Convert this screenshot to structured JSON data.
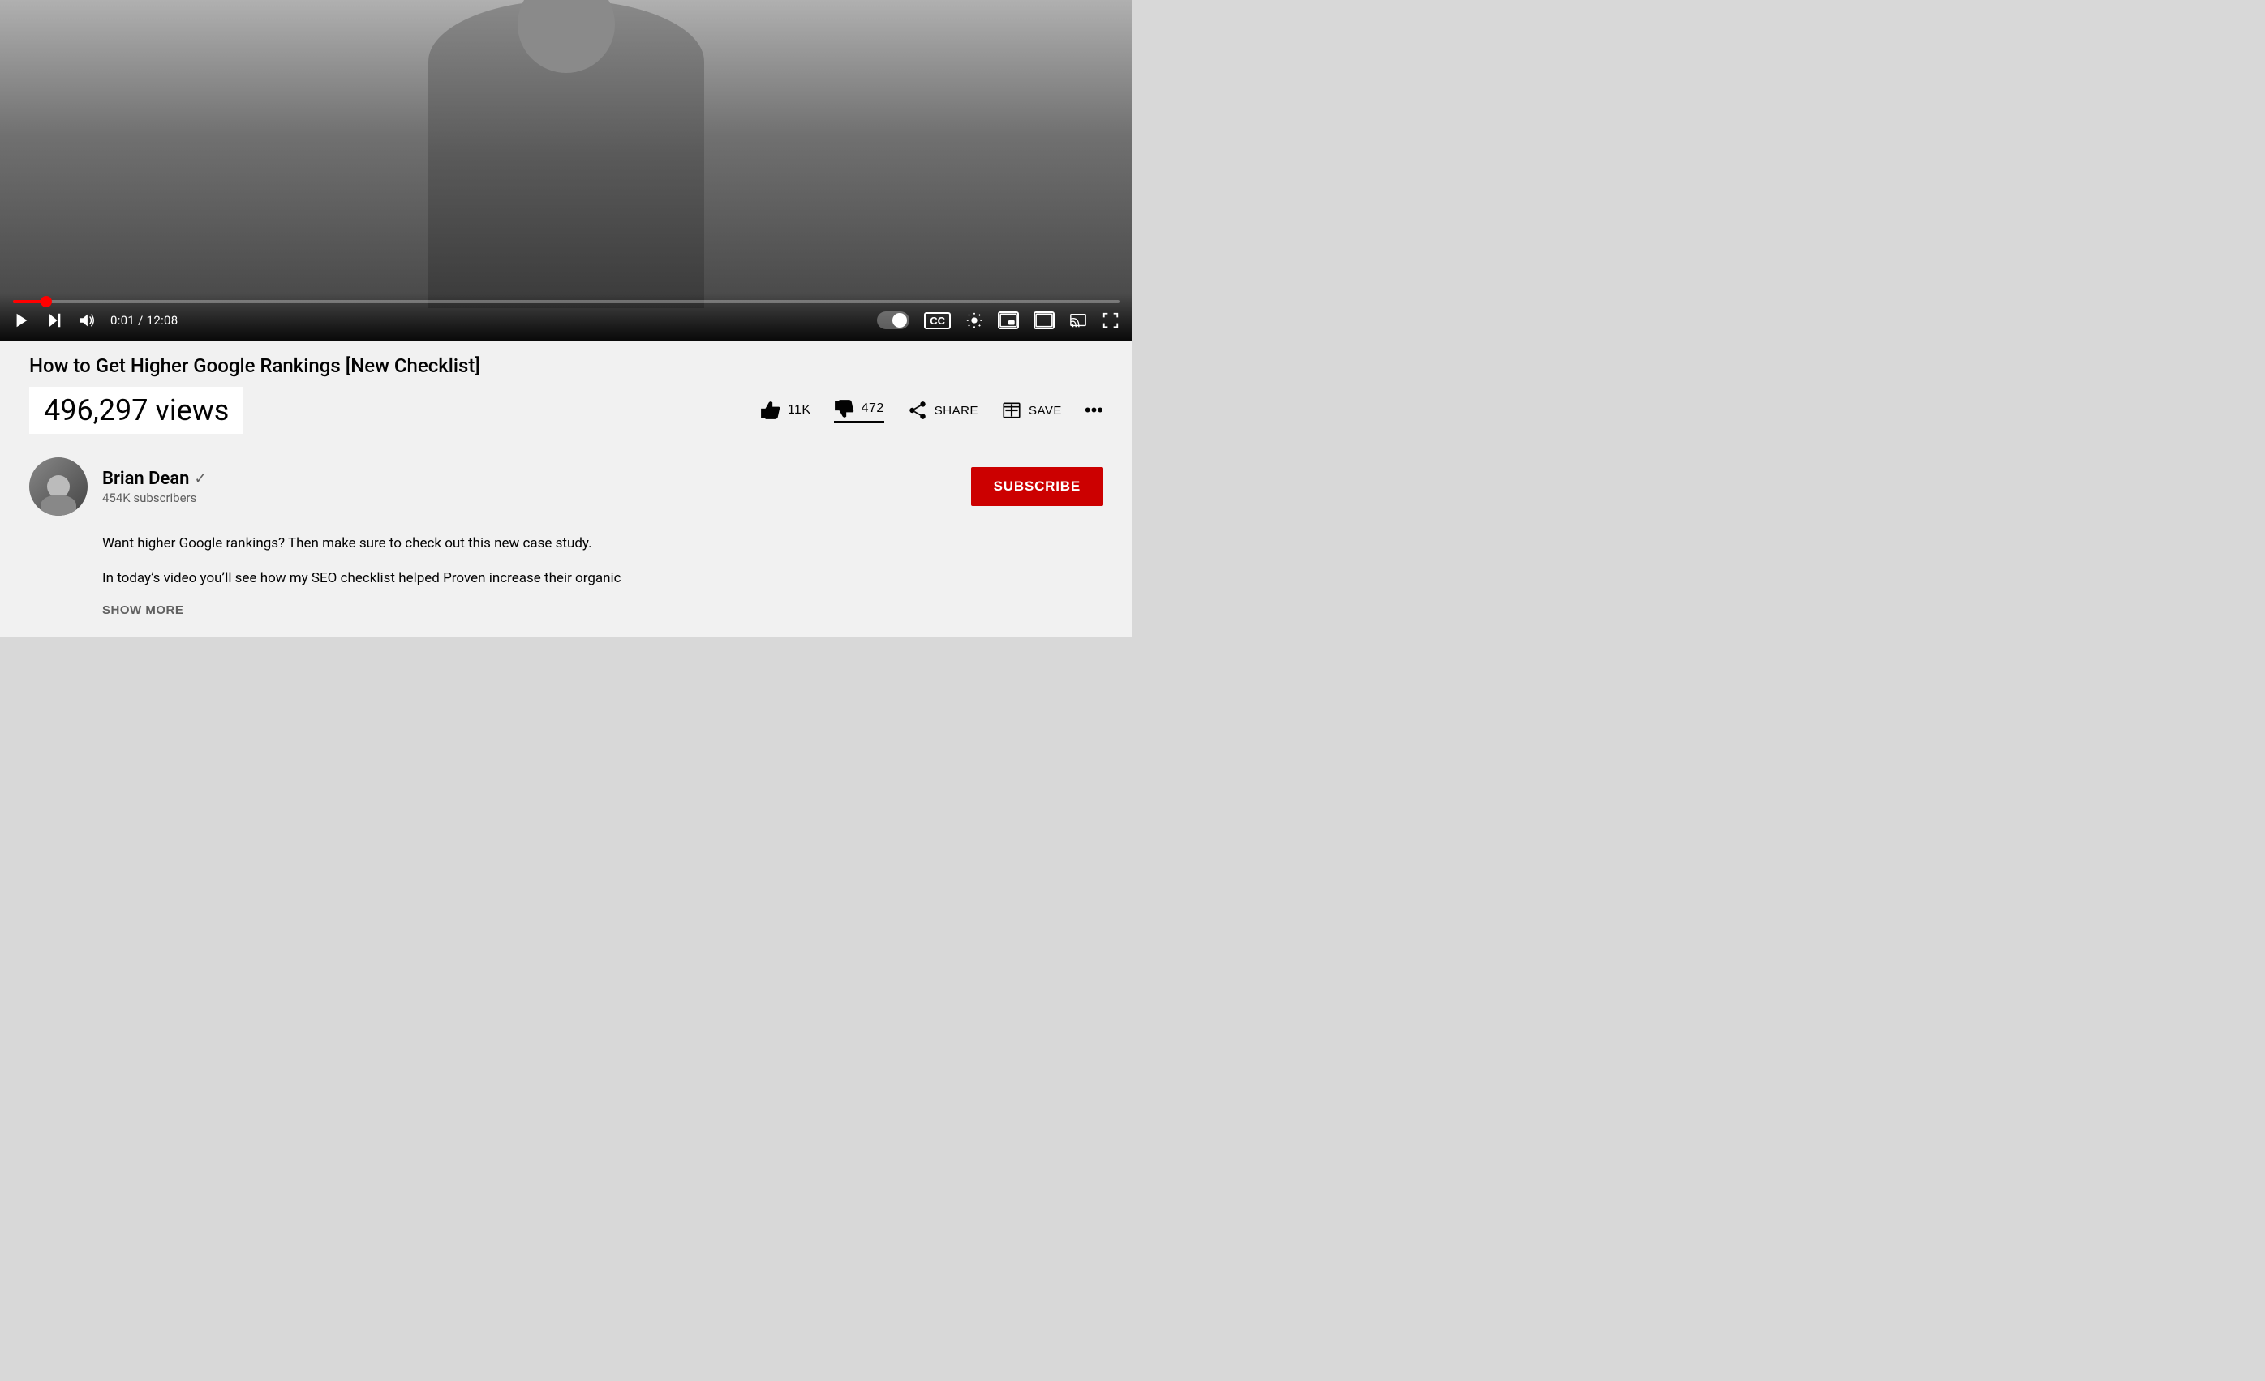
{
  "video": {
    "title": "How to Get Higher Google Rankings [New Checklist]",
    "views": "496,297 views",
    "progress_time": "0:01",
    "total_time": "12:08",
    "progress_percent": 3
  },
  "controls": {
    "play_label": "Play",
    "next_label": "Next",
    "volume_label": "Volume",
    "time_display": "0:01 / 12:08",
    "autoplay_label": "Autoplay",
    "cc_label": "CC",
    "settings_label": "Settings",
    "miniplayer_label": "Miniplayer",
    "theater_label": "Theater",
    "cast_label": "Cast",
    "fullscreen_label": "Fullscreen"
  },
  "actions": {
    "like_count": "11K",
    "dislike_count": "472",
    "share_label": "SHARE",
    "save_label": "SAVE",
    "more_label": "..."
  },
  "channel": {
    "name": "Brian Dean",
    "subscribers": "454K subscribers",
    "subscribe_label": "SUBSCRIBE"
  },
  "description": {
    "line1": "Want higher Google rankings? Then make sure to check out this new case study.",
    "line2": "In today’s video you’ll see how my SEO checklist helped Proven increase their organic",
    "show_more": "SHOW MORE"
  }
}
